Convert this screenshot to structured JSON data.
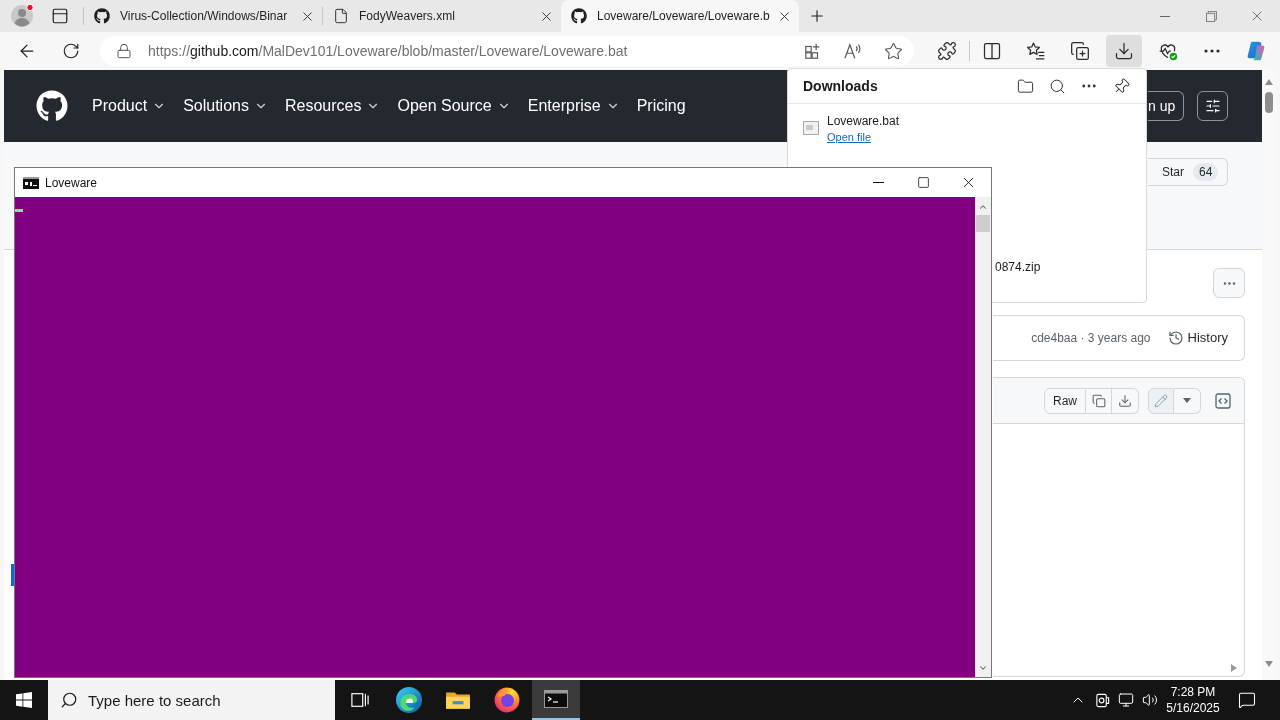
{
  "browser": {
    "tabs": [
      {
        "kind": "repository",
        "title": "Virus-Collection/Windows/Binar",
        "selected": false
      },
      {
        "kind": "document",
        "title": "FodyWeavers.xml",
        "selected": false
      },
      {
        "kind": "repository",
        "title": "Loveware/Loveware/Loveware.b",
        "selected": true
      }
    ],
    "address": {
      "scheme": "https://",
      "host": "github.com",
      "path": "/MalDev101/Loveware/blob/master/Loveware/Loveware.bat"
    },
    "toolbar_buttons": [
      {
        "kind": "extensions",
        "selected": false
      },
      {
        "kind": "split-screen",
        "selected": false
      },
      {
        "kind": "favorites",
        "selected": false
      },
      {
        "kind": "collections",
        "selected": false
      },
      {
        "kind": "downloads",
        "selected": true
      },
      {
        "kind": "essentials",
        "selected": false
      },
      {
        "kind": "more",
        "selected": false
      },
      {
        "kind": "assistant",
        "selected": false
      }
    ]
  },
  "github": {
    "nav": [
      {
        "label": "Product",
        "has_menu": true
      },
      {
        "label": "Solutions",
        "has_menu": true
      },
      {
        "label": "Resources",
        "has_menu": true
      },
      {
        "label": "Open Source",
        "has_menu": true
      },
      {
        "label": "Enterprise",
        "has_menu": true
      },
      {
        "label": "Pricing",
        "has_menu": false
      }
    ],
    "sign_up": "n up",
    "star": {
      "label": "Star",
      "count": "64"
    },
    "commit": "cde4baa · 3 years ago",
    "history": "History",
    "raw": "Raw"
  },
  "downloads": {
    "title": "Downloads",
    "items": [
      {
        "name": "Loveware.bat",
        "action": "Open file"
      },
      {
        "name": "0874.zip"
      }
    ]
  },
  "console": {
    "title": "Loveware"
  },
  "taskbar": {
    "search_placeholder": "Type here to search",
    "apps": [
      {
        "kind": "task-view",
        "selected": false
      },
      {
        "kind": "edge",
        "selected": false
      },
      {
        "kind": "explorer",
        "selected": false
      },
      {
        "kind": "firefox",
        "selected": false
      },
      {
        "kind": "terminal",
        "selected": true
      }
    ],
    "time": "7:28 PM",
    "date": "5/16/2025"
  }
}
